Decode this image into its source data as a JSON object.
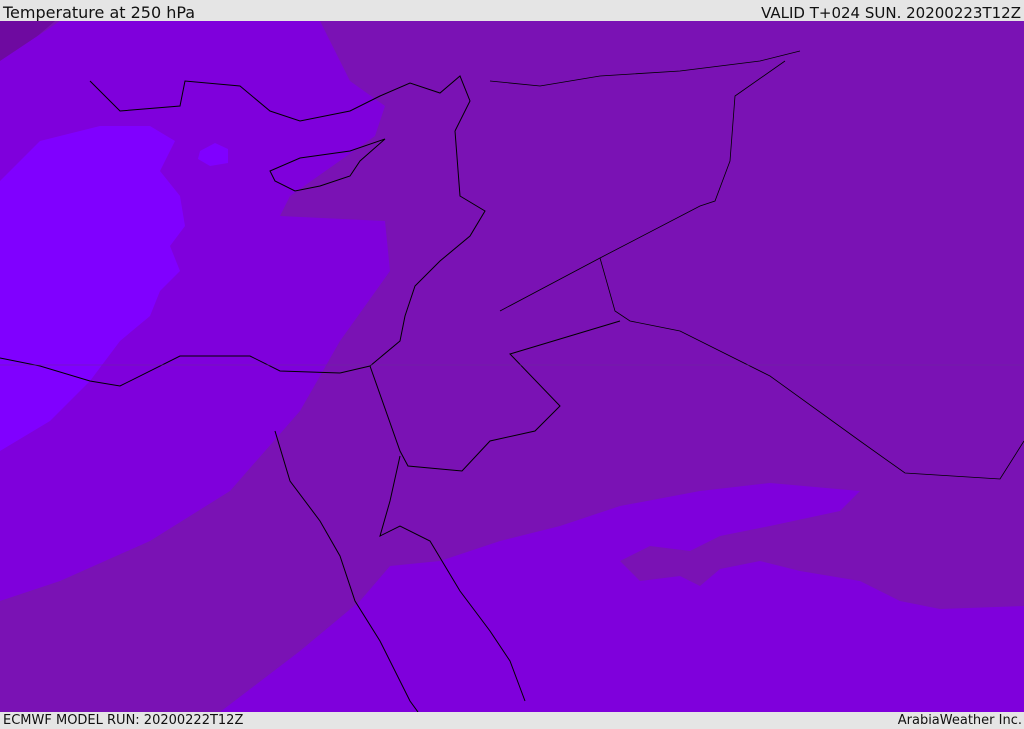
{
  "header": {
    "title": "Temperature at 250 hPa",
    "valid": "VALID T+024 SUN. 20200223T12Z"
  },
  "footer": {
    "model_run": "ECMWF MODEL RUN: 20200222T12Z",
    "credit": "ArabiaWeather Inc."
  },
  "map": {
    "colors": {
      "warmest": "#7a12b4",
      "mid": "#7f00dc",
      "coldest": "#8000ff",
      "dark_corner": "#6e0aa0"
    }
  }
}
